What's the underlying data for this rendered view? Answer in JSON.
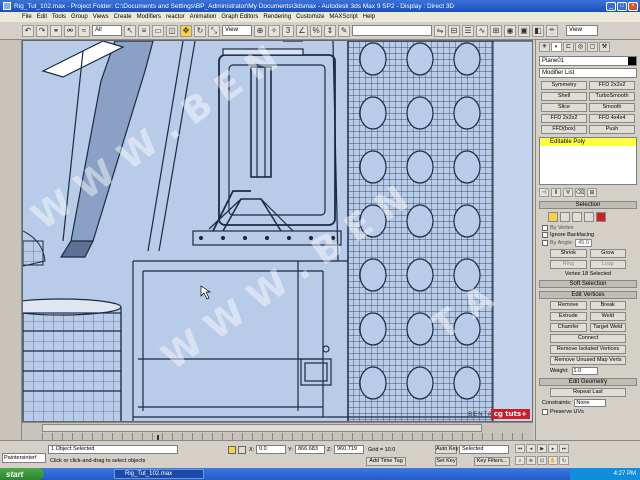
{
  "window": {
    "title": "Rig_Tut_102.max    -    Project Folder: C:\\Documents and Settings\\BP_Administrator\\My Documents\\3dsmax    -    Autodesk 3ds Max 9 SP2    -    Display : Direct 3D"
  },
  "menu": [
    "File",
    "Edit",
    "Tools",
    "Group",
    "Views",
    "Create",
    "Modifiers",
    "reactor",
    "Animation",
    "Graph Editors",
    "Rendering",
    "Customize",
    "MAXScript",
    "Help"
  ],
  "toolbar": {
    "filter_select": "All",
    "coord_select": "View",
    "named_select": "",
    "view_select": "View"
  },
  "command_panel": {
    "object_name": "Plane01",
    "modifier_list": "Modifier List",
    "modifier_buttons": [
      "Symmetry",
      "FFD 2x2x2",
      "Shell",
      "TurboSmooth",
      "Slice",
      "Smooth",
      "FFD 2x2x2",
      "FFD 4x4x4",
      "FFD(box)",
      "Push"
    ],
    "stack_item": "Editable Poly",
    "selection_rollout": "Selection",
    "by_vertex": "By Vertex",
    "ignore_backfacing": "Ignore Backfacing",
    "by_angle": "By Angle:",
    "by_angle_value": "45.0",
    "shrink": "Shrink",
    "grow": "Grow",
    "ring": "Ring",
    "loop": "Loop",
    "vertex_status": "Vertex 18 Selected",
    "soft_selection_rollout": "Soft Selection",
    "edit_vertices_rollout": "Edit Vertices",
    "remove": "Remove",
    "break": "Break",
    "extrude": "Extrude",
    "weld": "Weld",
    "chamfer": "Chamfer",
    "target_weld": "Target Weld",
    "connect": "Connect",
    "remove_isolated": "Remove Isolated Vertices",
    "remove_unused_map": "Remove Unused Map Verts",
    "weight_label": "Weight:",
    "weight_value": "1.0",
    "edit_geometry_rollout": "Edit Geometry",
    "repeat_last": "Repeat Last",
    "constraints_label": "Constraints:",
    "constraints_value": "None",
    "preserve_uvs": "Preserve UVs"
  },
  "viewport": {
    "brand_badge": "cg tuts+",
    "brand_sub": "BENTATE"
  },
  "status": {
    "maxscript": "Paintersinterf",
    "selection": "1 Object Selected",
    "prompt": "Click or click-and-drag to select objects",
    "x_label": "X:",
    "x_value": "0.0",
    "y_label": "Y:",
    "y_value": "866.683",
    "z_label": "Z:",
    "z_value": "960.719",
    "grid": "Grid = 10.0",
    "add_time_tag": "Add Time Tag",
    "auto_key": "Auto Key",
    "auto_key_select": "Selected",
    "set_key": "Set Key",
    "key_filters": "Key Filters..."
  },
  "taskbar": {
    "start": "start",
    "task": "Rig_Tut_102.max",
    "clock": "4:27 PM"
  }
}
